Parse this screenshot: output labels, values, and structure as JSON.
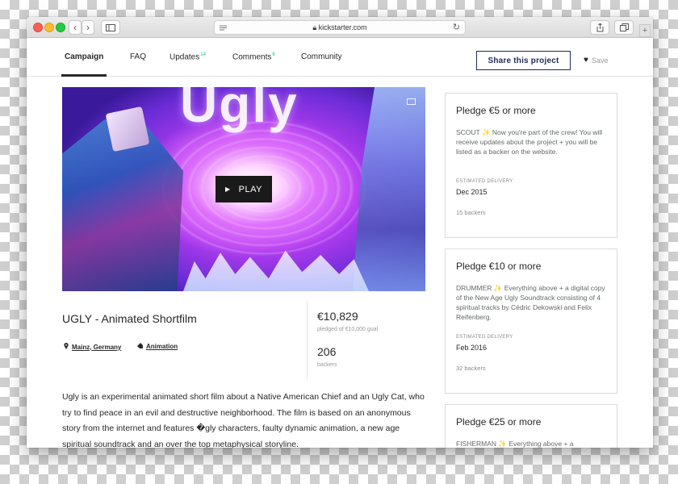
{
  "browser": {
    "url": "kickstarter.com"
  },
  "nav": {
    "tabs": [
      {
        "label": "Campaign",
        "count": ""
      },
      {
        "label": "FAQ",
        "count": ""
      },
      {
        "label": "Updates",
        "count": "14"
      },
      {
        "label": "Comments",
        "count": "6"
      },
      {
        "label": "Community",
        "count": ""
      }
    ],
    "share_label": "Share this project",
    "save_label": "Save"
  },
  "video": {
    "title_text": "Ugly",
    "play_label": "PLAY"
  },
  "project": {
    "title": "UGLY - Animated Shortfilm",
    "location": "Mainz, Germany",
    "category": "Animation",
    "pledged": "€10,829",
    "pledged_label": "pledged of €10,000 goal",
    "backers": "206",
    "backers_label": "backers",
    "description": "Ugly is an experimental animated short film about a Native American Chief and an Ugly Cat, who try to find peace in an evil and destructive neighborhood. The film is based on an anonymous story from the internet and features �gly characters, faulty dynamic animation, a new age spiritual soundtrack and an over the top metaphysical storyline."
  },
  "pledges": [
    {
      "amount": "Pledge €5 or more",
      "text": "SCOUT ✨ Now you're part of the crew! You will receive updates about the project + you will be listed as a backer on the website.",
      "delivery_label": "ESTIMATED DELIVERY",
      "delivery": "Dec 2015",
      "backers": "15 backers"
    },
    {
      "amount": "Pledge €10 or more",
      "text": "DRUMMER ✨ Everything above + a digital copy of the New Age Ugly Soundtrack consisting of 4 spiritual tracks by Cédric Dekowski and Felix Reifenberg.",
      "delivery_label": "ESTIMATED DELIVERY",
      "delivery": "Feb 2016",
      "backers": "32 backers"
    },
    {
      "amount": "Pledge €25 or more",
      "text": "FISHERMAN ✨ Everything above + a"
    }
  ]
}
